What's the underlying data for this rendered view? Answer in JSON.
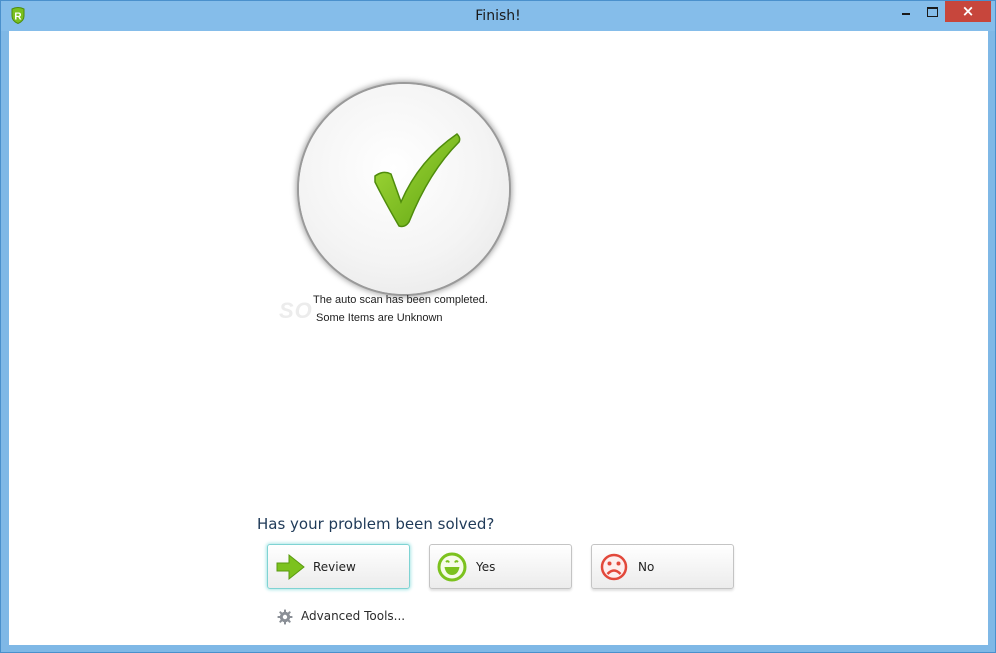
{
  "window": {
    "title": "Finish!",
    "icon": "shield-r-icon",
    "controls": {
      "minimize": "minimize-icon",
      "maximize": "maximize-icon",
      "close": "×"
    }
  },
  "status": {
    "icon": "checkmark-icon",
    "line1": "The auto scan has been completed.",
    "line2": "Some Items are Unknown",
    "watermark": "SO"
  },
  "feedback": {
    "question": "Has your problem been solved?",
    "buttons": [
      {
        "label": "Review",
        "icon": "arrow-right-icon"
      },
      {
        "label": "Yes",
        "icon": "smiley-happy-icon"
      },
      {
        "label": "No",
        "icon": "smiley-sad-icon"
      }
    ]
  },
  "advanced": {
    "label": "Advanced Tools...",
    "icon": "gear-icon"
  },
  "colors": {
    "accent_green": "#7cc21e",
    "sad_red": "#e2483b",
    "close_red": "#c7463c",
    "frame_blue": "#85bdea"
  }
}
